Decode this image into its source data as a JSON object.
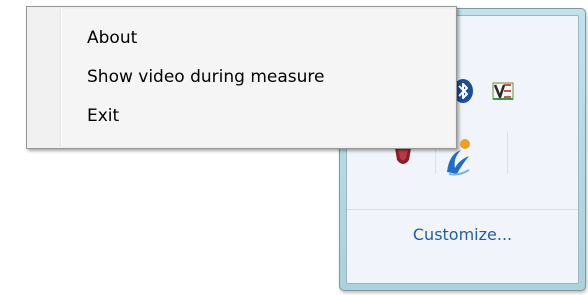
{
  "context_menu": {
    "items": [
      {
        "label": "About"
      },
      {
        "label": "Show video during measure"
      },
      {
        "label": "Exit"
      }
    ]
  },
  "tray_flyout": {
    "customize_label": "Customize...",
    "icons": [
      "bluetooth-icon",
      "vsmail-icon",
      "shield-icon",
      "swirl-app-icon"
    ]
  },
  "colors": {
    "link": "#1e5fa8",
    "menu_background": "#f0f0f0",
    "flyout_border": "#a7d3dd"
  }
}
